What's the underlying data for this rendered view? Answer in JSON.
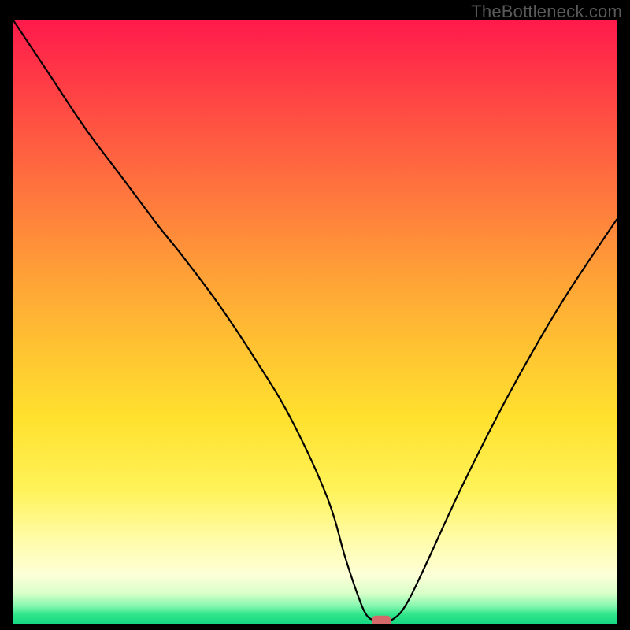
{
  "watermark": "TheBottleneck.com",
  "colors": {
    "background": "#000000",
    "curve": "#000000",
    "marker": "#d46a6a",
    "gradient_top": "#ff1a4b",
    "gradient_mid": "#ffe12e",
    "gradient_bottom": "#17d884"
  },
  "chart_data": {
    "type": "line",
    "title": "",
    "xlabel": "",
    "ylabel": "",
    "xlim": [
      0,
      100
    ],
    "ylim": [
      0,
      100
    ],
    "grid": false,
    "x": [
      0,
      6,
      12,
      18,
      24,
      28,
      34,
      40,
      46,
      52,
      55,
      57,
      58.5,
      60,
      61.5,
      63,
      65,
      68,
      74,
      80,
      86,
      92,
      100
    ],
    "values": [
      100,
      91,
      82,
      74,
      66,
      61,
      53,
      44,
      34,
      21,
      11,
      5,
      1.5,
      0.5,
      0.5,
      0.8,
      3,
      9,
      22,
      34,
      45,
      55,
      67
    ],
    "marker": {
      "x": 61,
      "y": 0.5,
      "shape": "rounded-rect"
    },
    "note": "x and y are percentages of the plot area; y=0 at bottom (green), y=100 at top (red)."
  }
}
